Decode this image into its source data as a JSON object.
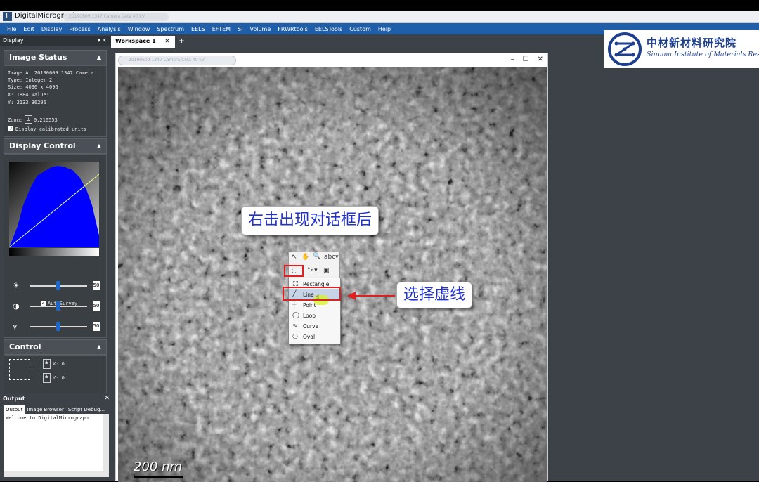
{
  "app": {
    "title": "DigitalMicrograph",
    "document_title": "20190609 1347 Camera Ceta 40 kV"
  },
  "menu": [
    "File",
    "Edit",
    "Display",
    "Process",
    "Analysis",
    "Window",
    "Spectrum",
    "EELS",
    "EFTEM",
    "SI",
    "Volume",
    "FRWRtools",
    "EELSTools",
    "Custom",
    "Help"
  ],
  "left_panel": {
    "title": "Display",
    "image_status": {
      "header": "Image Status",
      "image_line": "Image A: 20190609 1347 Camera",
      "type_line": "Type:  Integer 2",
      "size_line": "Size:  4096 x 4096",
      "x_line": "X:     1884      Value:",
      "y_line": "Y:     2133      36296",
      "zoom_label": "Zoom:",
      "zoom_value": "0.216553",
      "calibrated_label": "Display calibrated units"
    },
    "display_control": {
      "header": "Display Control",
      "autosurvey_label": "AutoSurvey",
      "sliders": [
        {
          "name": "brightness",
          "icon": "sun-icon",
          "value": "50",
          "level": 0.5
        },
        {
          "name": "contrast",
          "icon": "contrast-icon",
          "value": "50",
          "level": 0.5
        },
        {
          "name": "gamma",
          "icon": "gamma-icon",
          "value": "50",
          "level": 0.5
        }
      ]
    },
    "control": {
      "header": "Control",
      "x_label": "X:",
      "x_value": "0",
      "y_label": "Y:",
      "y_value": "0"
    }
  },
  "output": {
    "title": "Output",
    "tabs": [
      "Output",
      "Image Browser",
      "Script Debug..."
    ],
    "text": "Welcome to DigitalMicrograph"
  },
  "workspace": {
    "tab_label": "Workspace 1",
    "window_title": "20190609 1347 Camera Ceta 40 kV",
    "scale_bar_label": "200 nm"
  },
  "tool_menu": {
    "items": [
      "Rectangle",
      "Line",
      "Point",
      "Loop",
      "Curve",
      "Oval"
    ],
    "highlighted": "Line"
  },
  "callouts": {
    "right_click": "右击出现对话框后",
    "select_line": "选择虚线"
  },
  "logo": {
    "chinese": "中材新材料研究院",
    "english": "Sinoma Institute of Materials Research"
  },
  "colors": {
    "menubar": "#1f5ea8",
    "panel_bg": "#3c4248",
    "histogram": "#0000ff",
    "annotation_red": "#e02020",
    "callout_text": "#2233cc"
  }
}
